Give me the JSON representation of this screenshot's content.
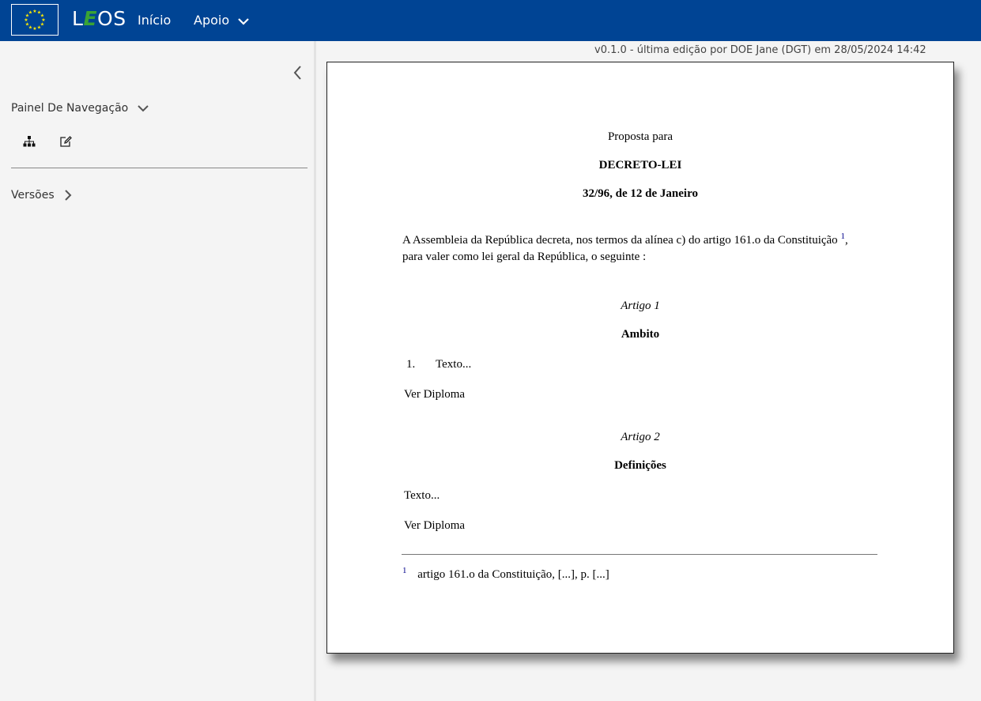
{
  "header": {
    "logo_alt": "EU flag",
    "brand_prefix": "L",
    "brand_e": "E",
    "brand_suffix": "OS",
    "nav": {
      "home": "Início",
      "support": "Apoio"
    },
    "colors": {
      "bar": "#004494",
      "brand_e": "#3aa335"
    }
  },
  "sidebar": {
    "collapse_icon": "chevron-left-icon",
    "panel_title": "Painel De Navegação",
    "tools": [
      "sitemap-icon",
      "edit-icon"
    ],
    "versions_label": "Versões"
  },
  "content": {
    "version_info": "v0.1.0 - última edição por DOE Jane (DGT) em 28/05/2024 14:42"
  },
  "document": {
    "preface": "Proposta para",
    "doc_type": "DECRETO-LEI",
    "doc_number": "32/96, de 12 de Janeiro",
    "preamble_text": "A Assembleia da República decreta, nos termos da alínea c) do artigo 161.o da Constituição",
    "preamble_ref": "1",
    "preamble_end": ",",
    "preamble_line2": "para valer como lei geral da República, o seguinte :",
    "articles": [
      {
        "num": "Artigo 1",
        "heading": "Ambito",
        "item_num": "1.",
        "item_text": "Texto...",
        "link": "Ver Diploma"
      },
      {
        "num": "Artigo 2",
        "heading": "Definições",
        "text": "Texto...",
        "link": "Ver Diploma"
      }
    ],
    "footnote": {
      "ref": "1",
      "text": "artigo 161.o da Constituição, [...], p. [...]"
    }
  }
}
